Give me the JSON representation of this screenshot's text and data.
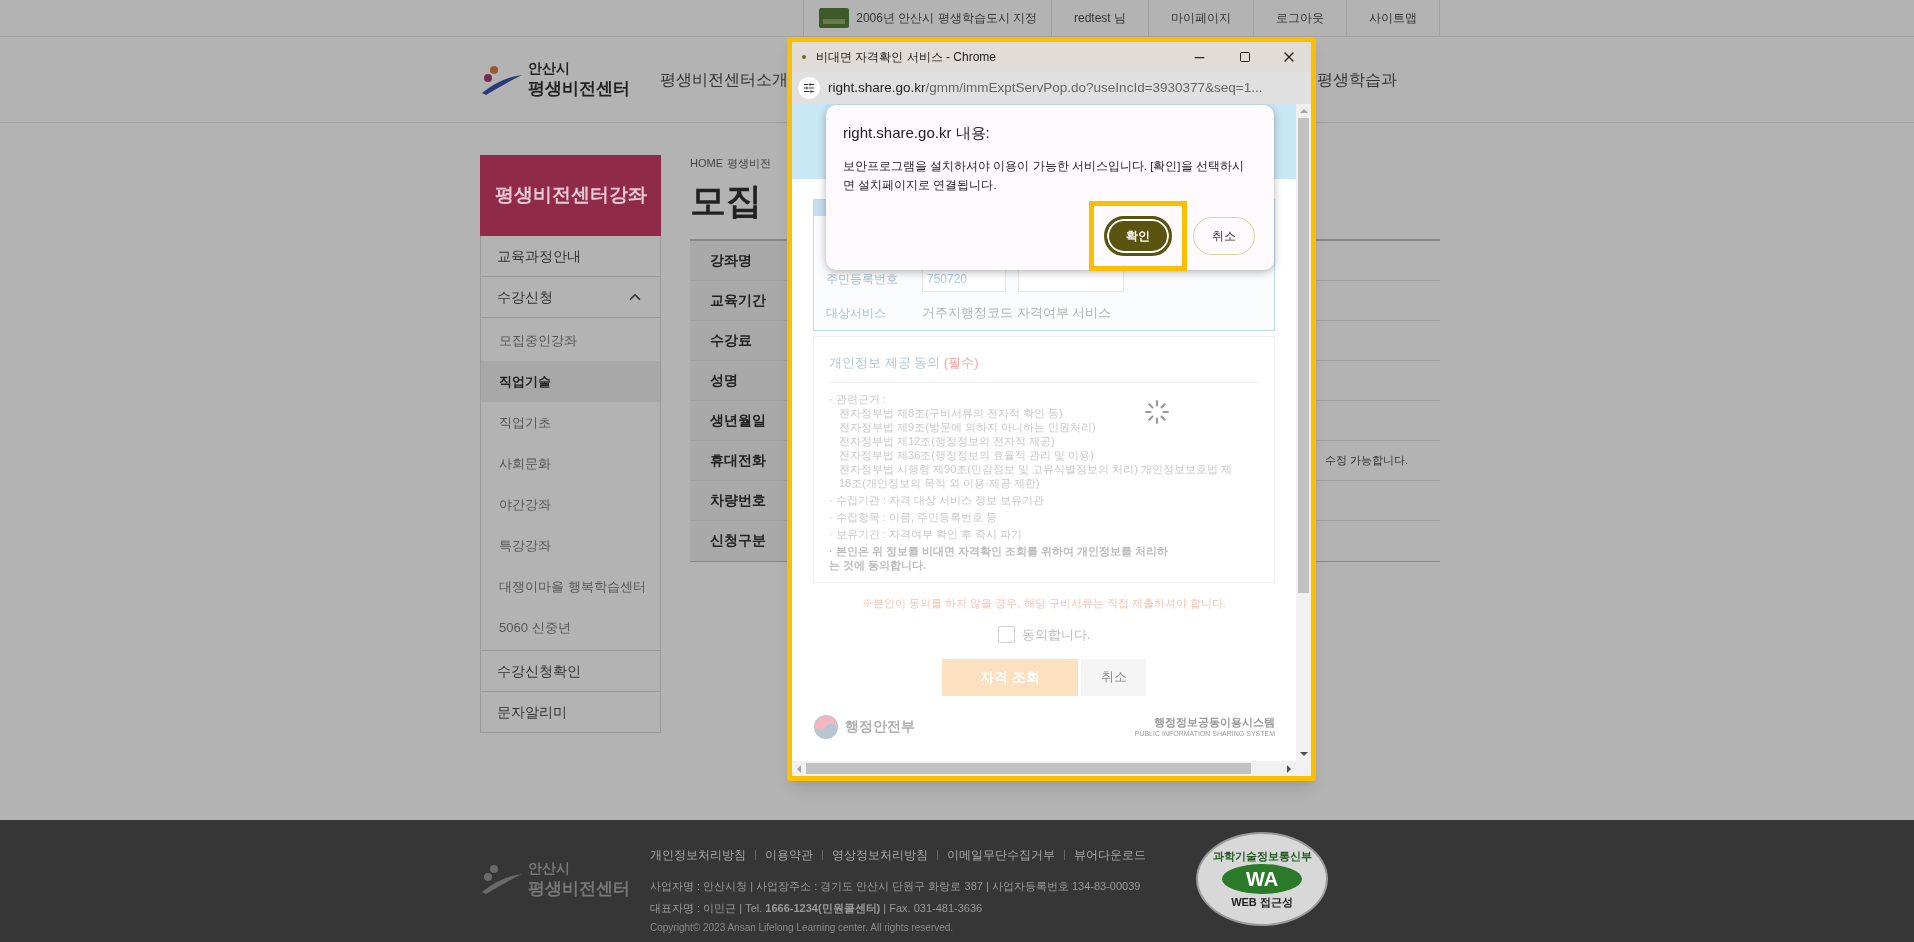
{
  "top_bar": {
    "award": "2006년 안산시 평생학습도시 지정",
    "links": [
      "redtest 님",
      "마이페이지",
      "로그아웃",
      "사이트맵"
    ]
  },
  "header": {
    "logo": {
      "city": "안산시",
      "name": "평생비전센터"
    },
    "nav": [
      "평생비전센터소개",
      "평생학습과"
    ]
  },
  "sidebar": {
    "title": "평생비전센터강좌",
    "items": [
      {
        "kind": "link",
        "label": "교육과정안내"
      },
      {
        "kind": "group",
        "label": "수강신청",
        "expanded": true,
        "children": [
          {
            "label": "모집중인강좌",
            "selected": false
          },
          {
            "label": "직업기술",
            "selected": true
          },
          {
            "label": "직업기초",
            "selected": false
          },
          {
            "label": "사회문화",
            "selected": false
          },
          {
            "label": "야간강좌",
            "selected": false
          },
          {
            "label": "특강강좌",
            "selected": false
          },
          {
            "label": "대쟁이마을 행복학습센터",
            "selected": false
          },
          {
            "label": "5060 신중년",
            "selected": false
          }
        ]
      },
      {
        "kind": "link",
        "label": "수강신청확인"
      },
      {
        "kind": "link",
        "label": "문자알리미"
      }
    ]
  },
  "main": {
    "breadcrumb": [
      "HOME",
      "평생비전"
    ],
    "title": "모집",
    "table": {
      "rows": [
        {
          "label": "강좌명"
        },
        {
          "label": "교육기간"
        },
        {
          "label": "수강료"
        },
        {
          "label": "성명"
        },
        {
          "label": "생년월일"
        },
        {
          "label": "휴대전화",
          "note": "수정 가능합니다."
        },
        {
          "label": "차량번호"
        },
        {
          "label": "신청구분"
        }
      ]
    }
  },
  "popup": {
    "window_title": "비대면 자격확인 서비스 - Chrome",
    "url_host": "right.share.go.kr",
    "url_path": "/gmm/immExptServPop.do?useIncId=3930377&seq=1...",
    "form": {
      "rows": [
        {
          "kind": "inputs",
          "label": "주민등록번호",
          "value": "750720"
        },
        {
          "kind": "text",
          "label": "대상서비스",
          "value": "거주지행정코드 자격여부 서비스"
        }
      ]
    },
    "consent": {
      "title": "개인정보 제공 동의",
      "required_mark": "(필수)",
      "items": [
        {
          "kind": "basis",
          "text": "· 관련근거 :",
          "lines": [
            "전자정부법 제8조(구비서류의 전자적 확인 등)",
            "전자정부법 제9조(방문에 의하지 아니하는 민원처리)",
            "전자정부법 제12조(행정정보의 전자적 제공)",
            "전자정부법 제36조(행정정보의 효율적 관리 및 이용)",
            "전자정부법 시행령 제90조(민감정보 및 고유식별정보의 처리) 개인정보보호법 제18조(개인정보의 목적 외 이용·제공 제한)"
          ]
        },
        {
          "kind": "plain",
          "text": "· 수집기관 : 자격 대상 서비스 정보 보유기관"
        },
        {
          "kind": "plain",
          "text": "· 수집항목 : 이름, 주민등록번호 등"
        },
        {
          "kind": "plain",
          "text": "· 보유기간 : 자격여부 확인 후 즉시 파기"
        },
        {
          "kind": "bold",
          "text": "· 본인은 위 정보를 비대면 자격확인 조회를 위하여 개인정보를 처리하는 것에 동의합니다."
        }
      ]
    },
    "notice": "※본인이 동의를 하지 않을 경우, 해당 구비서류는 직접 제출하셔야 합니다.",
    "agree": {
      "label": "동의합니다.",
      "checked": false
    },
    "buttons": [
      "자격 조회",
      "취소"
    ],
    "ministry": "행정안전부",
    "system": {
      "name": "행정정보공동이용시스템",
      "english": "PUBLIC INFORMATION SHARING SYSTEM"
    },
    "alert": {
      "title": "right.share.go.kr 내용:",
      "message": "보안프로그램을 설치하셔야 이용이 가능한 서비스입니다. [확인]을 선택하시면 설치페이지로 연결됩니다.",
      "buttons": [
        {
          "label": "확인",
          "kind": "primary"
        },
        {
          "label": "취소",
          "kind": "secondary"
        }
      ]
    }
  },
  "footer": {
    "logo": {
      "city": "안산시",
      "name": "평생비전센터"
    },
    "links": [
      "개인정보처리방침",
      "이용약관",
      "영상정보처리방침",
      "이메일무단수집거부",
      "뷰어다운로드"
    ],
    "info": [
      "사업자명 : 안산시청 | 사업장주소 : 경기도 안산시 단원구 화랑로 387 | 사업자등록번호 134-83-00039",
      "대표자명 : 이민근 | Tel. **1666-1234(민원콜센터)** | Fax. 031-481-3636"
    ],
    "copyright": "Copyright© 2023 Ansan Lifelong Learning center. All rights reserved.",
    "badge": {
      "top": "과학기술정보통신부",
      "mark": "WA",
      "bottom": "WEB 접근성"
    }
  }
}
